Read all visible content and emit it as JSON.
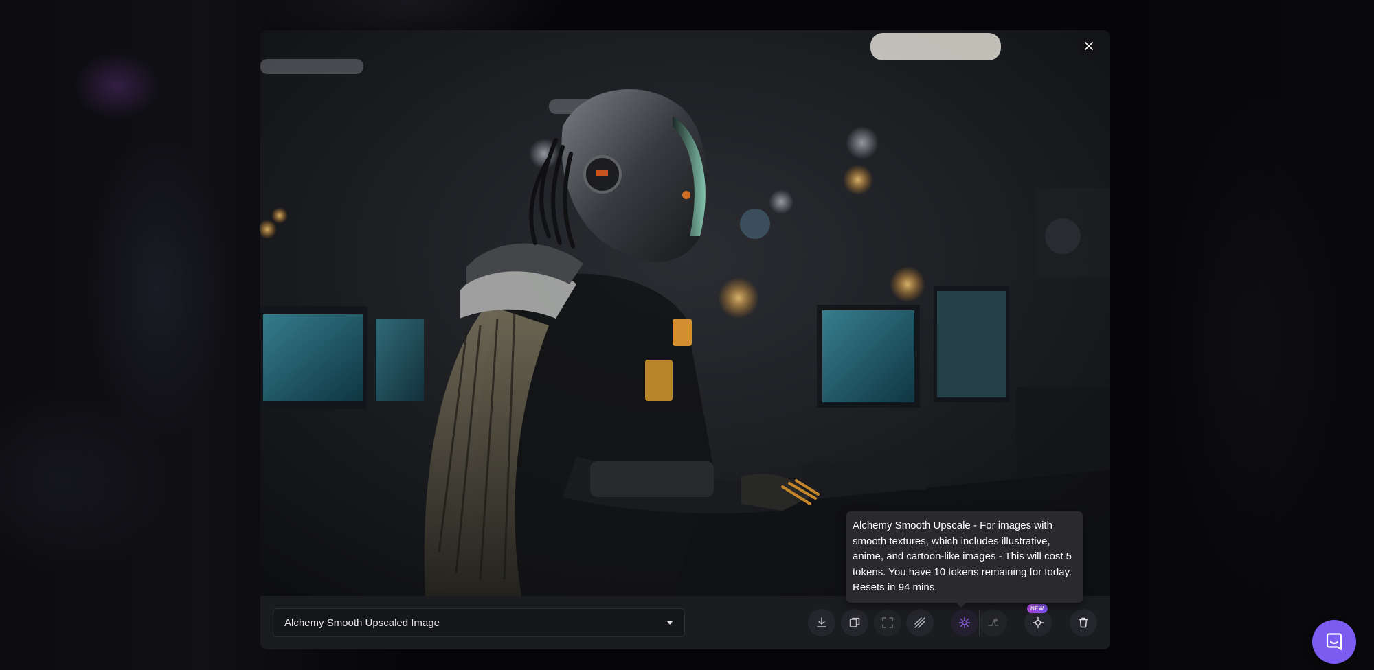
{
  "modal": {
    "image_alt": "Generated image: armored cyborg figure with feathered shoulder typing at a computer terminal",
    "close_icon": "close-icon"
  },
  "toolbar": {
    "variant_select": {
      "value": "Alchemy Smooth Upscaled Image",
      "icon": "chevron-down-icon"
    },
    "buttons": [
      {
        "name": "download-button",
        "icon": "download-icon"
      },
      {
        "name": "copy-button",
        "icon": "copy-icon"
      },
      {
        "name": "expand-button",
        "icon": "expand-icon"
      },
      {
        "name": "remove-background-button",
        "icon": "hatch-icon"
      },
      {
        "name": "alchemy-smooth-upscale-button",
        "icon": "smooth-upscale-icon"
      },
      {
        "name": "alchemy-crisp-upscale-button",
        "icon": "crisp-upscale-icon"
      },
      {
        "name": "motion-button",
        "icon": "motion-icon",
        "badge": "NEW"
      },
      {
        "name": "delete-button",
        "icon": "trash-icon"
      }
    ]
  },
  "tooltip": {
    "text": "Alchemy Smooth Upscale - For images with smooth textures, which includes illustrative, anime, and cartoon-like images - This will cost 5 tokens. You have 10 tokens remaining for today. Resets in 94 mins."
  },
  "chat": {
    "icon": "chat-icon"
  },
  "colors": {
    "accent": "#7b5cf0",
    "toolbar_bg": "#1b1c20",
    "badge": "#b54be6"
  }
}
